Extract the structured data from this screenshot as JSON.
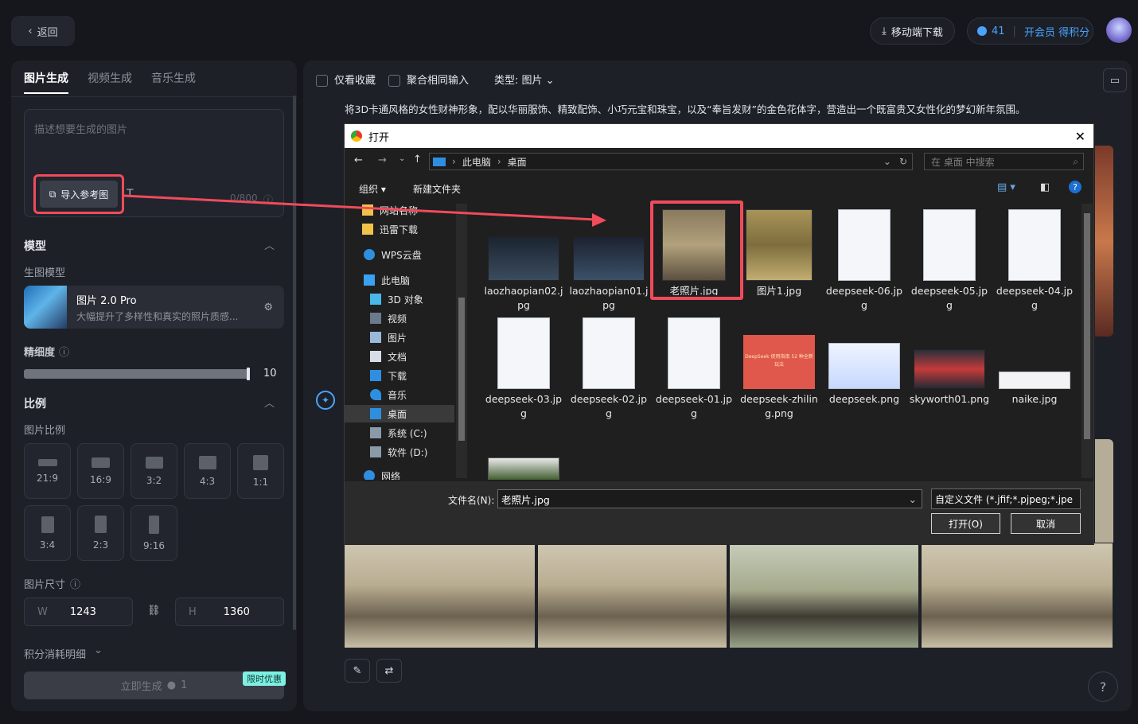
{
  "header": {
    "back_label": "返回",
    "mobile_download": "移动端下载",
    "points": "41",
    "vip_label": "开会员 得积分"
  },
  "left": {
    "tabs": [
      "图片生成",
      "视频生成",
      "音乐生成"
    ],
    "prompt_placeholder": "描述想要生成的图片",
    "import_label": "导入参考图",
    "char_count": "0/800",
    "model_section": "模型",
    "model_sub": "生图模型",
    "model_name": "图片 2.0 Pro",
    "model_desc": "大幅提升了多样性和真实的照片质感...",
    "fineness_label": "精细度",
    "fineness_value": "10",
    "fineness_level": 1.0,
    "ratio_section": "比例",
    "ratio_sub": "图片比例",
    "ratios": [
      "21:9",
      "16:9",
      "3:2",
      "4:3",
      "1:1",
      "3:4",
      "2:3",
      "9:16"
    ],
    "size_label": "图片尺寸",
    "width_label": "W",
    "width_value": "1243",
    "height_label": "H",
    "height_value": "1360",
    "points_detail": "积分消耗明细",
    "generate_label": "立即生成",
    "generate_cost": "1",
    "promo_label": "限时优惠"
  },
  "main": {
    "filter_favorites": "仅看收藏",
    "filter_merge": "聚合相同输入",
    "type_filter": "类型: 图片",
    "prompt_text": "将3D卡通风格的女性财神形象，配以华丽服饰、精致配饰、小巧元宝和珠宝，以及“奉旨发财”的金色花体字，营造出一个既富贵又女性化的梦幻新年氛围。",
    "help": "?"
  },
  "dialog": {
    "title": "打开",
    "path": [
      "此电脑",
      "桌面"
    ],
    "search_placeholder": "在 桌面 中搜索",
    "organize": "组织",
    "new_folder": "新建文件夹",
    "nav": [
      "网站名称",
      "迅雷下载",
      "WPS云盘",
      "此电脑",
      "3D 对象",
      "视频",
      "图片",
      "文档",
      "下载",
      "音乐",
      "桌面",
      "系统 (C:)",
      "软件 (D:)",
      "网络"
    ],
    "files": [
      "laozhaopian02.jpg",
      "laozhaopian01.jpg",
      "老照片.jpg",
      "图片1.jpg",
      "deepseek-06.jpg",
      "deepseek-05.jpg",
      "deepseek-04.jpg",
      "deepseek-03.jpg",
      "deepseek-02.jpg",
      "deepseek-01.jpg",
      "deepseek-zhiling.png",
      "deepseek.png",
      "skyworth01.png",
      "naike.jpg"
    ],
    "filename_label": "文件名(N):",
    "filename_value": "老照片.jpg",
    "filetype": "自定义文件 (*.jfif;*.pjpeg;*.jpe",
    "open_label": "打开(O)",
    "cancel_label": "取消",
    "banner_text": "DeepSeek 使用指南 52 种全新玩法"
  },
  "colors": {
    "accent_red": "#f04b5b",
    "link_blue": "#4aa3ff",
    "promo": "#7ef0e2"
  }
}
